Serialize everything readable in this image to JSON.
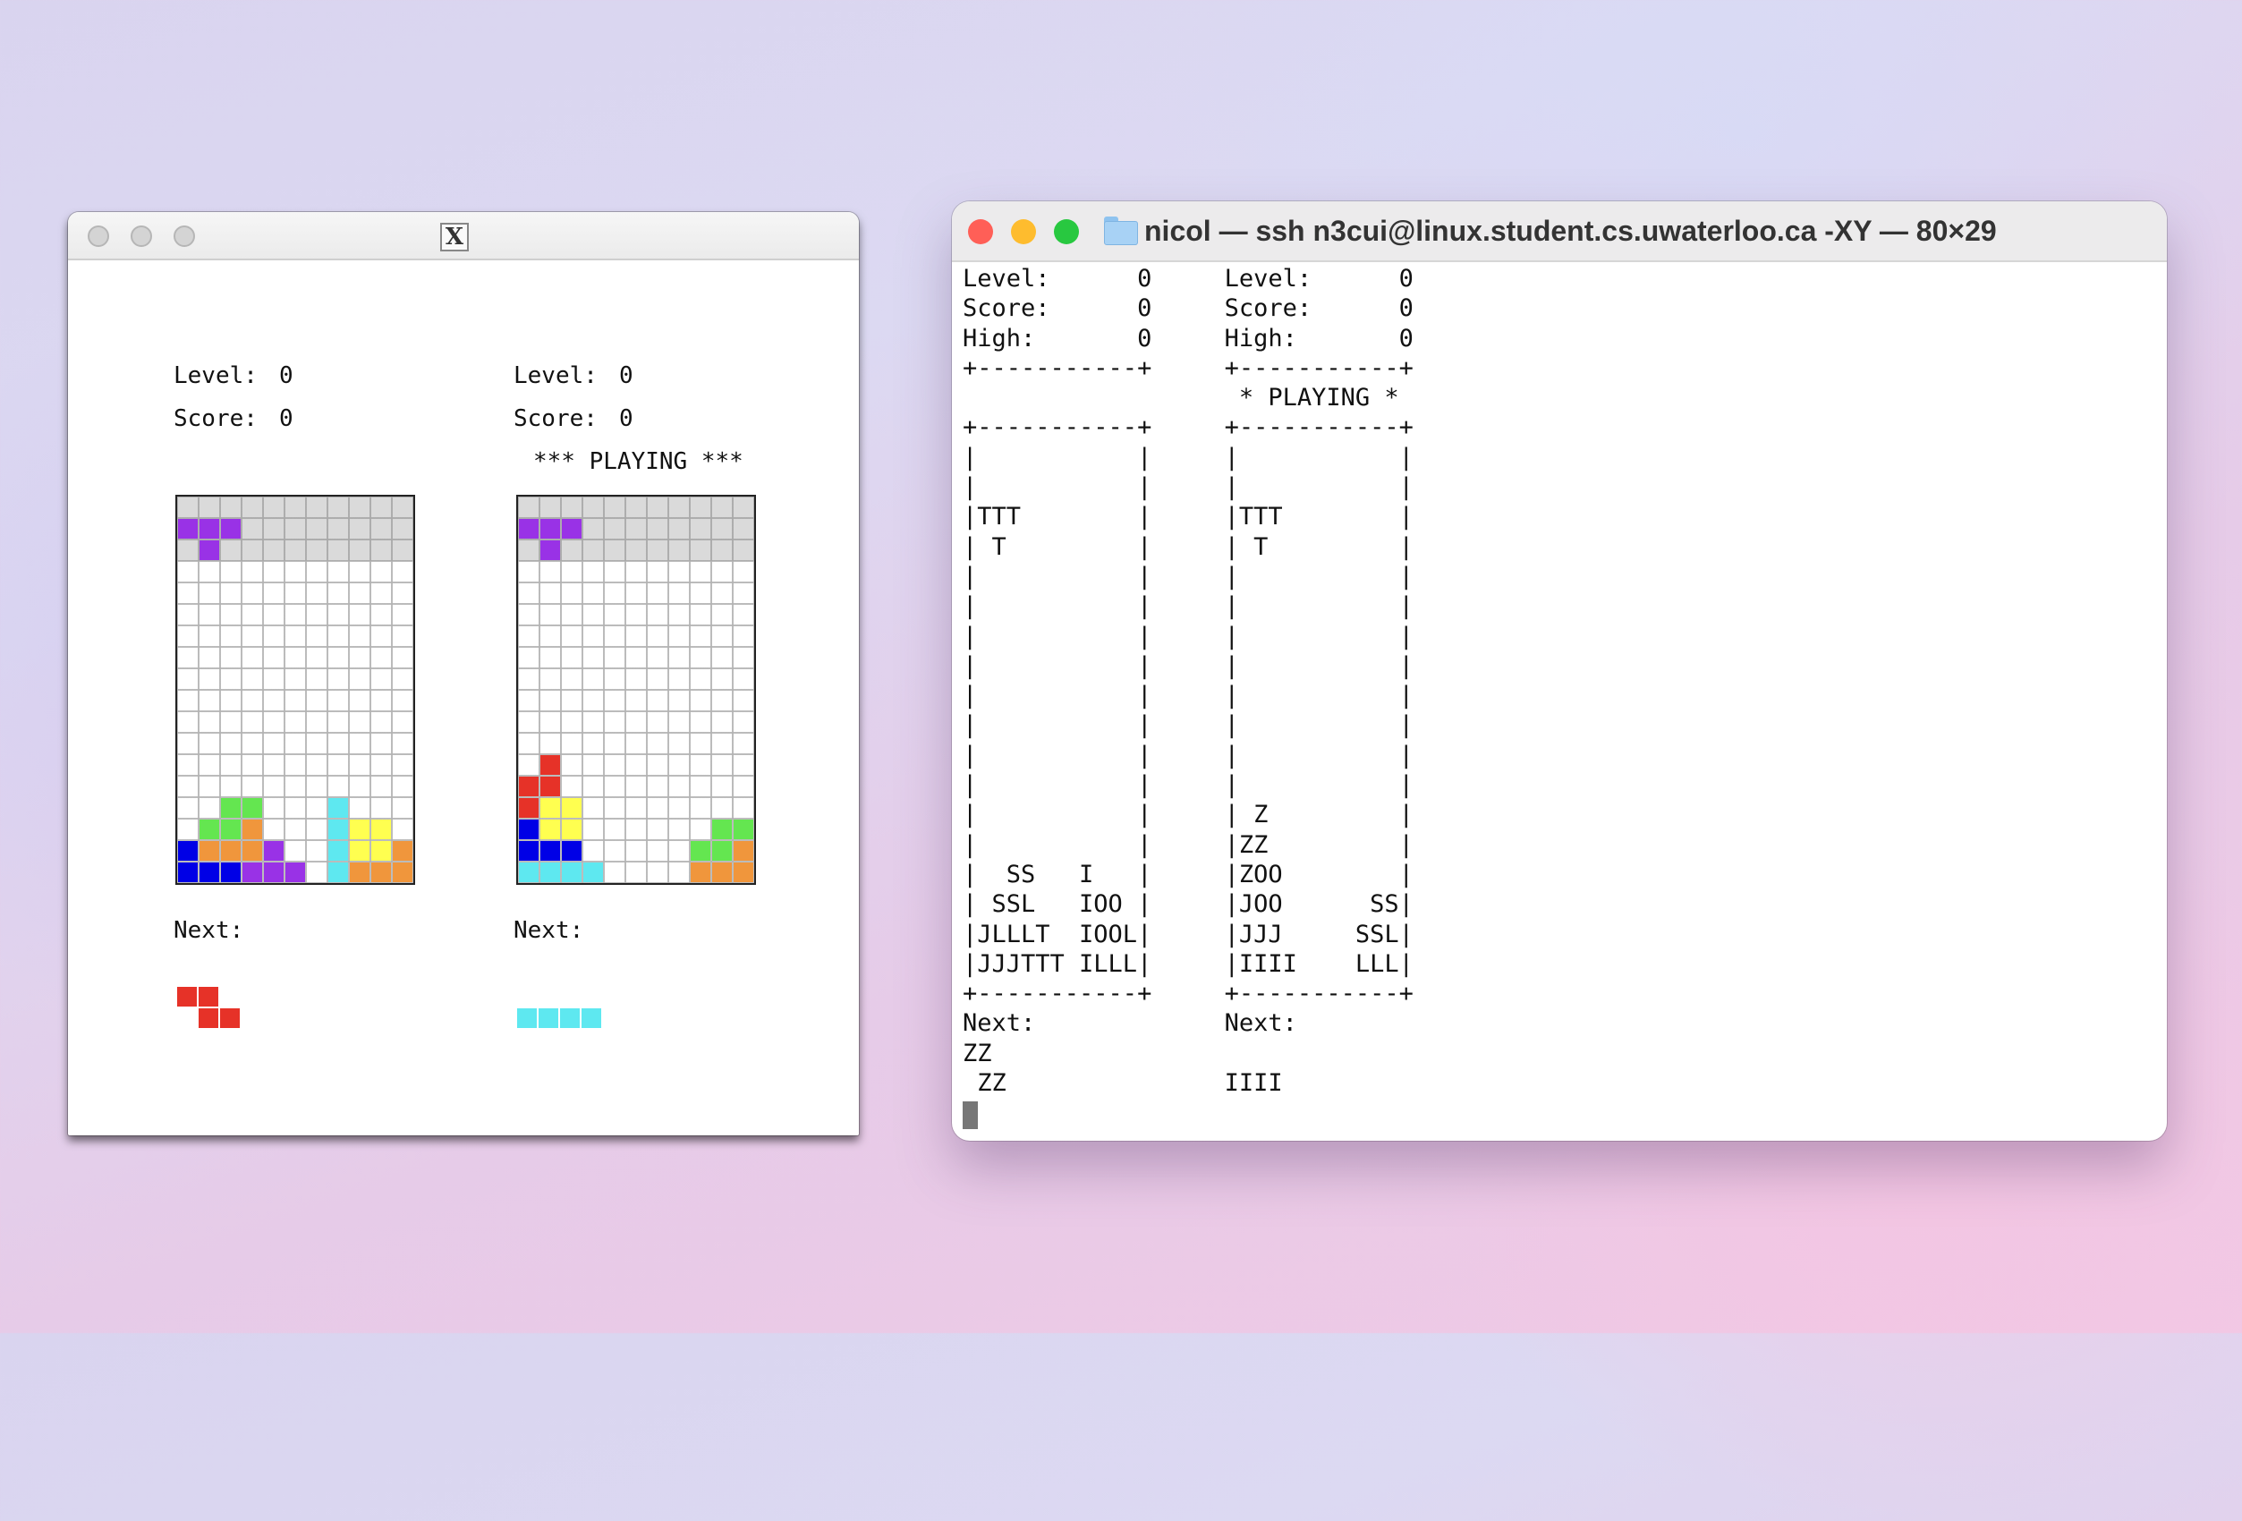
{
  "x11_window": {
    "logo_glyph": "X",
    "traffic_light_color": "#d4d4d4",
    "players": [
      {
        "level_label": "Level:",
        "level": "0",
        "score_label": "Score:",
        "score": "0",
        "status": "",
        "next_label": "Next:",
        "next_piece": "Z",
        "board_cells": [
          [
            0,
            1,
            "#9932e6"
          ],
          [
            1,
            1,
            "#9932e6"
          ],
          [
            2,
            1,
            "#9932e6"
          ],
          [
            1,
            2,
            "#9932e6"
          ],
          [
            2,
            14,
            "#64e650"
          ],
          [
            3,
            14,
            "#64e650"
          ],
          [
            7,
            14,
            "#5ee8f0"
          ],
          [
            1,
            15,
            "#64e650"
          ],
          [
            2,
            15,
            "#64e650"
          ],
          [
            3,
            15,
            "#f0963c"
          ],
          [
            7,
            15,
            "#5ee8f0"
          ],
          [
            8,
            15,
            "#ffff50"
          ],
          [
            9,
            15,
            "#ffff50"
          ],
          [
            0,
            16,
            "#0000e6"
          ],
          [
            1,
            16,
            "#f0963c"
          ],
          [
            2,
            16,
            "#f0963c"
          ],
          [
            3,
            16,
            "#f0963c"
          ],
          [
            4,
            16,
            "#9932e6"
          ],
          [
            7,
            16,
            "#5ee8f0"
          ],
          [
            8,
            16,
            "#ffff50"
          ],
          [
            9,
            16,
            "#ffff50"
          ],
          [
            10,
            16,
            "#f0963c"
          ],
          [
            0,
            17,
            "#0000e6"
          ],
          [
            1,
            17,
            "#0000e6"
          ],
          [
            2,
            17,
            "#0000e6"
          ],
          [
            3,
            17,
            "#9932e6"
          ],
          [
            4,
            17,
            "#9932e6"
          ],
          [
            5,
            17,
            "#9932e6"
          ],
          [
            7,
            17,
            "#5ee8f0"
          ],
          [
            8,
            17,
            "#f0963c"
          ],
          [
            9,
            17,
            "#f0963c"
          ],
          [
            10,
            17,
            "#f0963c"
          ]
        ]
      },
      {
        "level_label": "Level:",
        "level": "0",
        "score_label": "Score:",
        "score": "0",
        "status": "*** PLAYING ***",
        "next_label": "Next:",
        "next_piece": "I",
        "board_cells": [
          [
            0,
            1,
            "#9932e6"
          ],
          [
            1,
            1,
            "#9932e6"
          ],
          [
            2,
            1,
            "#9932e6"
          ],
          [
            1,
            2,
            "#9932e6"
          ],
          [
            1,
            12,
            "#e63228"
          ],
          [
            0,
            13,
            "#e63228"
          ],
          [
            1,
            13,
            "#e63228"
          ],
          [
            0,
            14,
            "#e63228"
          ],
          [
            1,
            14,
            "#ffff50"
          ],
          [
            2,
            14,
            "#ffff50"
          ],
          [
            0,
            15,
            "#0000e6"
          ],
          [
            1,
            15,
            "#ffff50"
          ],
          [
            2,
            15,
            "#ffff50"
          ],
          [
            9,
            15,
            "#64e650"
          ],
          [
            10,
            15,
            "#64e650"
          ],
          [
            0,
            16,
            "#0000e6"
          ],
          [
            1,
            16,
            "#0000e6"
          ],
          [
            2,
            16,
            "#0000e6"
          ],
          [
            8,
            16,
            "#64e650"
          ],
          [
            9,
            16,
            "#64e650"
          ],
          [
            10,
            16,
            "#f0963c"
          ],
          [
            0,
            17,
            "#5ee8f0"
          ],
          [
            1,
            17,
            "#5ee8f0"
          ],
          [
            2,
            17,
            "#5ee8f0"
          ],
          [
            3,
            17,
            "#5ee8f0"
          ],
          [
            8,
            17,
            "#f0963c"
          ],
          [
            9,
            17,
            "#f0963c"
          ],
          [
            10,
            17,
            "#f0963c"
          ]
        ]
      }
    ],
    "next_pieces": {
      "Z": {
        "color": "#e63228",
        "cells": [
          [
            0,
            0
          ],
          [
            1,
            0
          ],
          [
            1,
            1
          ],
          [
            2,
            1
          ]
        ]
      },
      "I": {
        "color": "#5ee8f0",
        "cells": [
          [
            0,
            0
          ],
          [
            1,
            0
          ],
          [
            2,
            0
          ],
          [
            3,
            0
          ]
        ]
      }
    }
  },
  "terminal_window": {
    "title": "nicol — ssh n3cui@linux.student.cs.uwaterloo.ca -XY — 80×29",
    "traffic_lights": {
      "close": "#ff5f57",
      "minimize": "#febc2e",
      "zoom": "#28c840"
    },
    "folder_icon_color": "#a8d2f5",
    "lines": [
      "Level:      0     Level:      0",
      "Score:      0     Score:      0",
      "High:       0     High:       0",
      "+-----------+     +-----------+",
      "                   * PLAYING *",
      "+-----------+     +-----------+",
      "|           |     |           |",
      "|           |     |           |",
      "|TTT        |     |TTT        |",
      "| T         |     | T         |",
      "|           |     |           |",
      "|           |     |           |",
      "|           |     |           |",
      "|           |     |           |",
      "|           |     |           |",
      "|           |     |           |",
      "|           |     |           |",
      "|           |     |           |",
      "|           |     | Z         |",
      "|           |     |ZZ         |",
      "|  SS   I   |     |ZOO        |",
      "| SSL   IOO |     |JOO      SS|",
      "|JLLLT  IOOL|     |JJJ     SSL|",
      "|JJJTTT ILLL|     |IIII    LLL|",
      "+-----------+     +-----------+",
      "Next:             Next:",
      "ZZ",
      " ZZ               IIII"
    ]
  }
}
